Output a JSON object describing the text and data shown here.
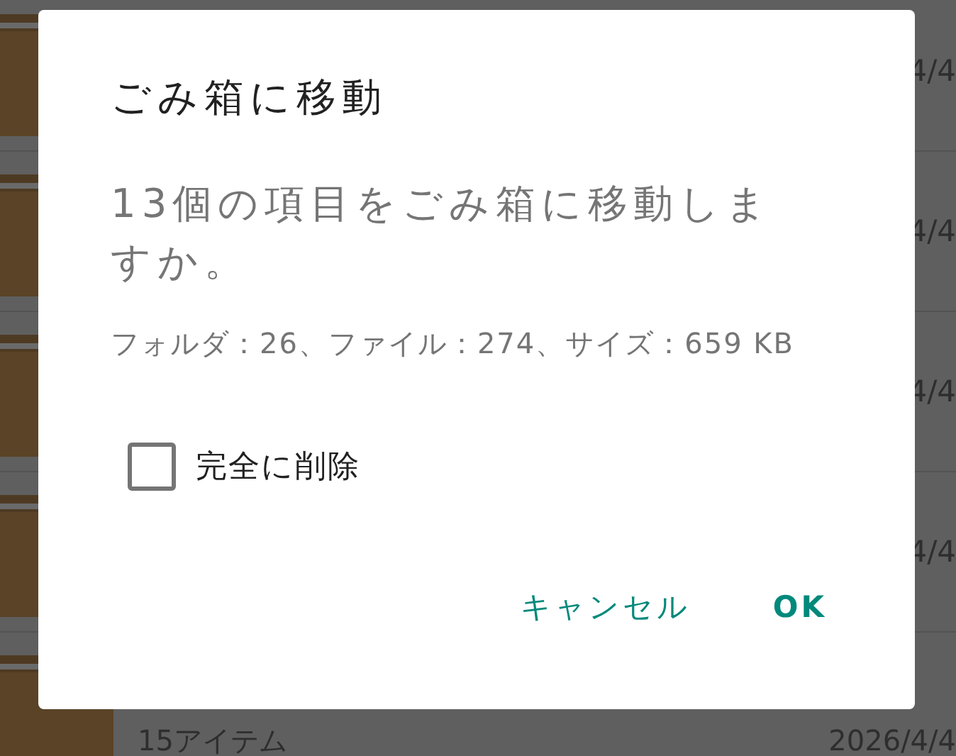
{
  "background_list": {
    "rows": [
      {
        "date": "4/4"
      },
      {
        "date": "4/4"
      },
      {
        "date": "4/4"
      },
      {
        "date": "4/4"
      },
      {
        "caption": "15アイテム",
        "date": "2026/4/4"
      }
    ]
  },
  "dialog": {
    "title": "ごみ箱に移動",
    "message": "13個の項目をごみ箱に移動しますか。",
    "details": "フォルダ：26、ファイル：274、サイズ：659 KB",
    "checkbox": {
      "label": "完全に削除",
      "checked": false
    },
    "buttons": [
      {
        "label": "キャンセル",
        "kind": "normal"
      },
      {
        "label": "OK",
        "kind": "primary"
      }
    ]
  }
}
